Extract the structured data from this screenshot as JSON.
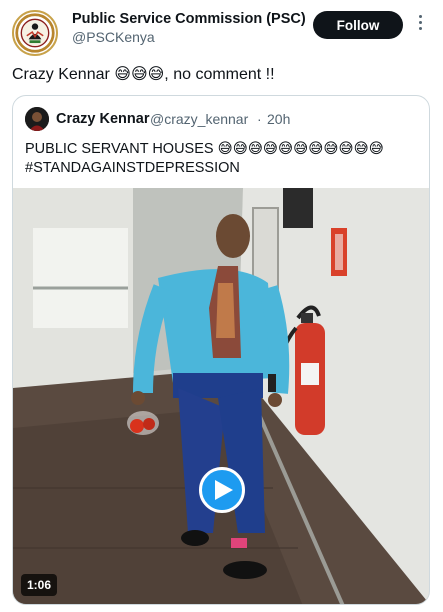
{
  "author": {
    "name": "Public Service Commission (PSC)",
    "handle": "@PSCKenya",
    "avatar_icon": "psc-logo-icon"
  },
  "follow_label": "Follow",
  "more_icon": "more-vertical-icon",
  "tweet_text": "Crazy Kennar 😅😅😅, no comment !!",
  "quoted": {
    "name": "Crazy Kennar",
    "handle": "@crazy_kennar",
    "separator": "·",
    "time": "20h",
    "line1": "PUBLIC SERVANT HOUSES 😅😅😅😅😅😅😅😅😅😅😅",
    "line2": "#STANDAGAINSTDEPRESSION"
  },
  "video": {
    "duration": "1:06",
    "play_icon": "play-icon"
  },
  "colors": {
    "accent": "#1d9bf0",
    "follow_bg": "#0f1419",
    "secondary_text": "#536471",
    "border": "#cfd9de"
  }
}
